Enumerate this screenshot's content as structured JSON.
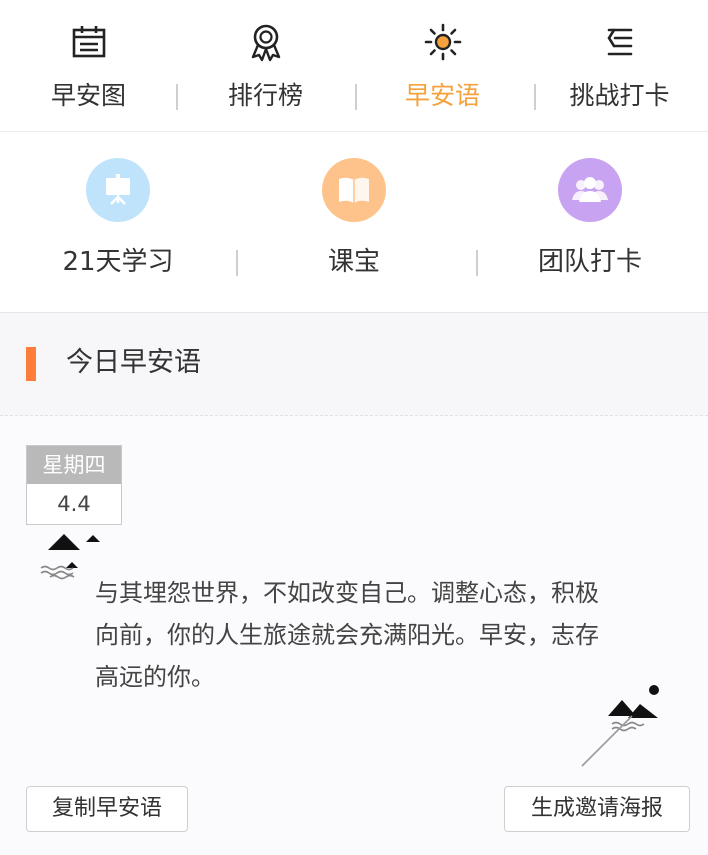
{
  "tabs": [
    {
      "label": "早安图",
      "icon": "calendar-icon",
      "active": false
    },
    {
      "label": "排行榜",
      "icon": "medal-icon",
      "active": false
    },
    {
      "label": "早安语",
      "icon": "sun-icon",
      "active": true
    },
    {
      "label": "挑战打卡",
      "icon": "list-icon",
      "active": false
    }
  ],
  "shortcuts": [
    {
      "label": "21天学习",
      "icon": "easel-icon",
      "color": "#bfe3fb"
    },
    {
      "label": "课宝",
      "icon": "book-icon",
      "color": "#fdc38b"
    },
    {
      "label": "团队打卡",
      "icon": "team-icon",
      "color": "#c8a3f2"
    }
  ],
  "section": {
    "title": "今日早安语",
    "accent": "#ff7d3b"
  },
  "card": {
    "weekday": "星期四",
    "date": "4.4",
    "quote": "与其埋怨世界，不如改变自己。调整心态，积极向前，你的人生旅途就会充满阳光。早安，志存高远的你。"
  },
  "buttons": {
    "copy": "复制早安语",
    "poster": "生成邀请海报"
  },
  "colors": {
    "active_tab": "#f5a13c"
  }
}
